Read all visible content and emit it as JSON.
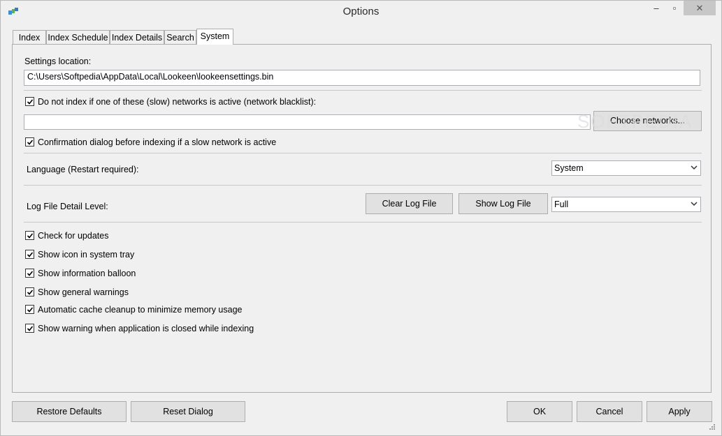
{
  "window": {
    "title": "Options",
    "minimize": "–",
    "maximize": "▫",
    "close": "✕"
  },
  "tabs": [
    {
      "label": "Index"
    },
    {
      "label": "Index Schedule"
    },
    {
      "label": "Index Details"
    },
    {
      "label": "Search"
    },
    {
      "label": "System"
    }
  ],
  "system": {
    "settings_location_label": "Settings location:",
    "settings_location_value": "C:\\Users\\Softpedia\\AppData\\Local\\Lookeen\\lookeensettings.bin",
    "network_blacklist_label": "Do not index if one of these (slow) networks is active (network blacklist):",
    "network_blacklist_value": "",
    "choose_networks_button": "Choose networks...",
    "confirmation_dialog_label": "Confirmation dialog before indexing if a slow network is active",
    "language_label": "Language (Restart required):",
    "language_value": "System",
    "log_level_label": "Log File Detail Level:",
    "clear_log_button": "Clear Log File",
    "show_log_button": "Show Log File",
    "log_level_value": "Full",
    "options": [
      {
        "label": "Check for updates",
        "checked": true
      },
      {
        "label": "Show icon in system tray",
        "checked": true
      },
      {
        "label": "Show information balloon",
        "checked": true
      },
      {
        "label": "Show general warnings",
        "checked": true
      },
      {
        "label": "Automatic cache cleanup to minimize memory usage",
        "checked": true
      },
      {
        "label": "Show warning when application is closed while indexing",
        "checked": true
      }
    ]
  },
  "footer": {
    "restore_defaults": "Restore Defaults",
    "reset_dialog": "Reset Dialog",
    "ok": "OK",
    "cancel": "Cancel",
    "apply": "Apply"
  },
  "watermark": "SOFTPEDIA"
}
